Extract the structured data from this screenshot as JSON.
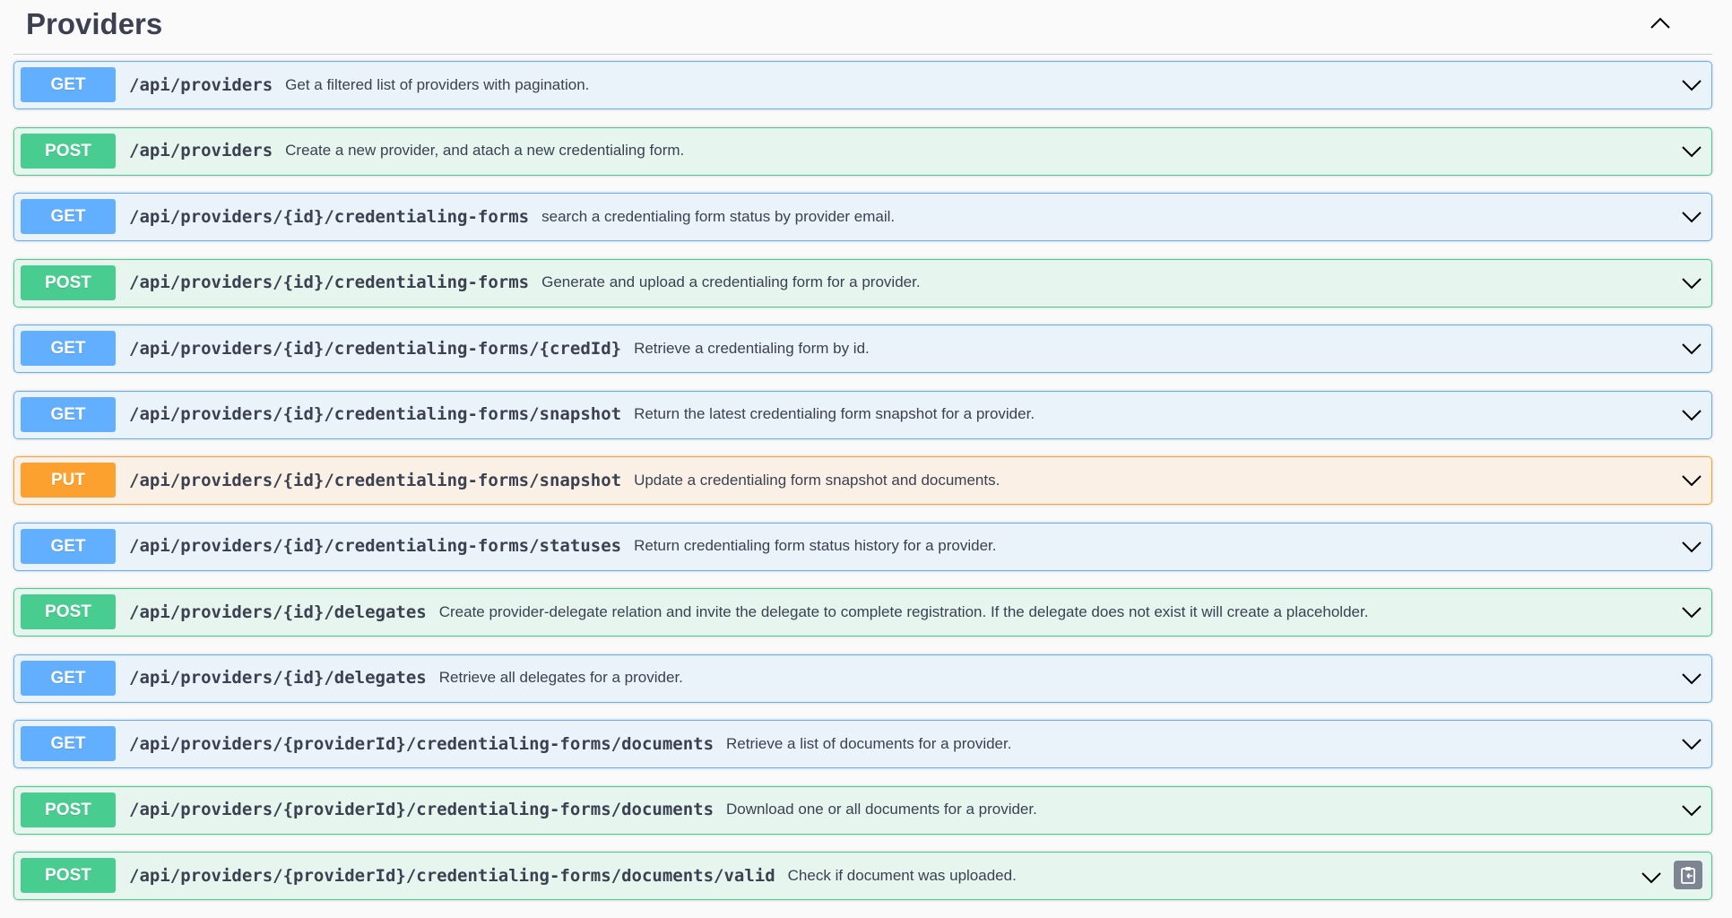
{
  "section": {
    "title": "Providers"
  },
  "operations": [
    {
      "method": "GET",
      "path": "/api/providers",
      "summary": "Get a filtered list of providers with pagination."
    },
    {
      "method": "POST",
      "path": "/api/providers",
      "summary": "Create a new provider, and atach a new credentialing form."
    },
    {
      "method": "GET",
      "path": "/api/providers/{id}/credentialing-forms",
      "summary": "search a credentialing form status by provider email."
    },
    {
      "method": "POST",
      "path": "/api/providers/{id}/credentialing-forms",
      "summary": "Generate and upload a credentialing form for a provider."
    },
    {
      "method": "GET",
      "path": "/api/providers/{id}/credentialing-forms/{credId}",
      "summary": "Retrieve a credentialing form by id."
    },
    {
      "method": "GET",
      "path": "/api/providers/{id}/credentialing-forms/snapshot",
      "summary": "Return the latest credentialing form snapshot for a provider."
    },
    {
      "method": "PUT",
      "path": "/api/providers/{id}/credentialing-forms/snapshot",
      "summary": "Update a credentialing form snapshot and documents."
    },
    {
      "method": "GET",
      "path": "/api/providers/{id}/credentialing-forms/statuses",
      "summary": "Return credentialing form status history for a provider."
    },
    {
      "method": "POST",
      "path": "/api/providers/{id}/delegates",
      "summary": "Create provider-delegate relation and invite the delegate to complete registration. If the delegate does not exist it will create a placeholder."
    },
    {
      "method": "GET",
      "path": "/api/providers/{id}/delegates",
      "summary": "Retrieve all delegates for a provider."
    },
    {
      "method": "GET",
      "path": "/api/providers/{providerId}/credentialing-forms/documents",
      "summary": "Retrieve a list of documents for a provider."
    },
    {
      "method": "POST",
      "path": "/api/providers/{providerId}/credentialing-forms/documents",
      "summary": "Download one or all documents for a provider."
    },
    {
      "method": "POST",
      "path": "/api/providers/{providerId}/credentialing-forms/documents/valid",
      "summary": "Check if document was uploaded."
    }
  ],
  "colors": {
    "GET": "#61affe",
    "POST": "#49cc90",
    "PUT": "#fca130",
    "text": "#3b4151"
  },
  "icons": {
    "collapse": "chevron-up-icon",
    "expand": "chevron-down-icon",
    "copy": "copy-to-clipboard-icon"
  }
}
